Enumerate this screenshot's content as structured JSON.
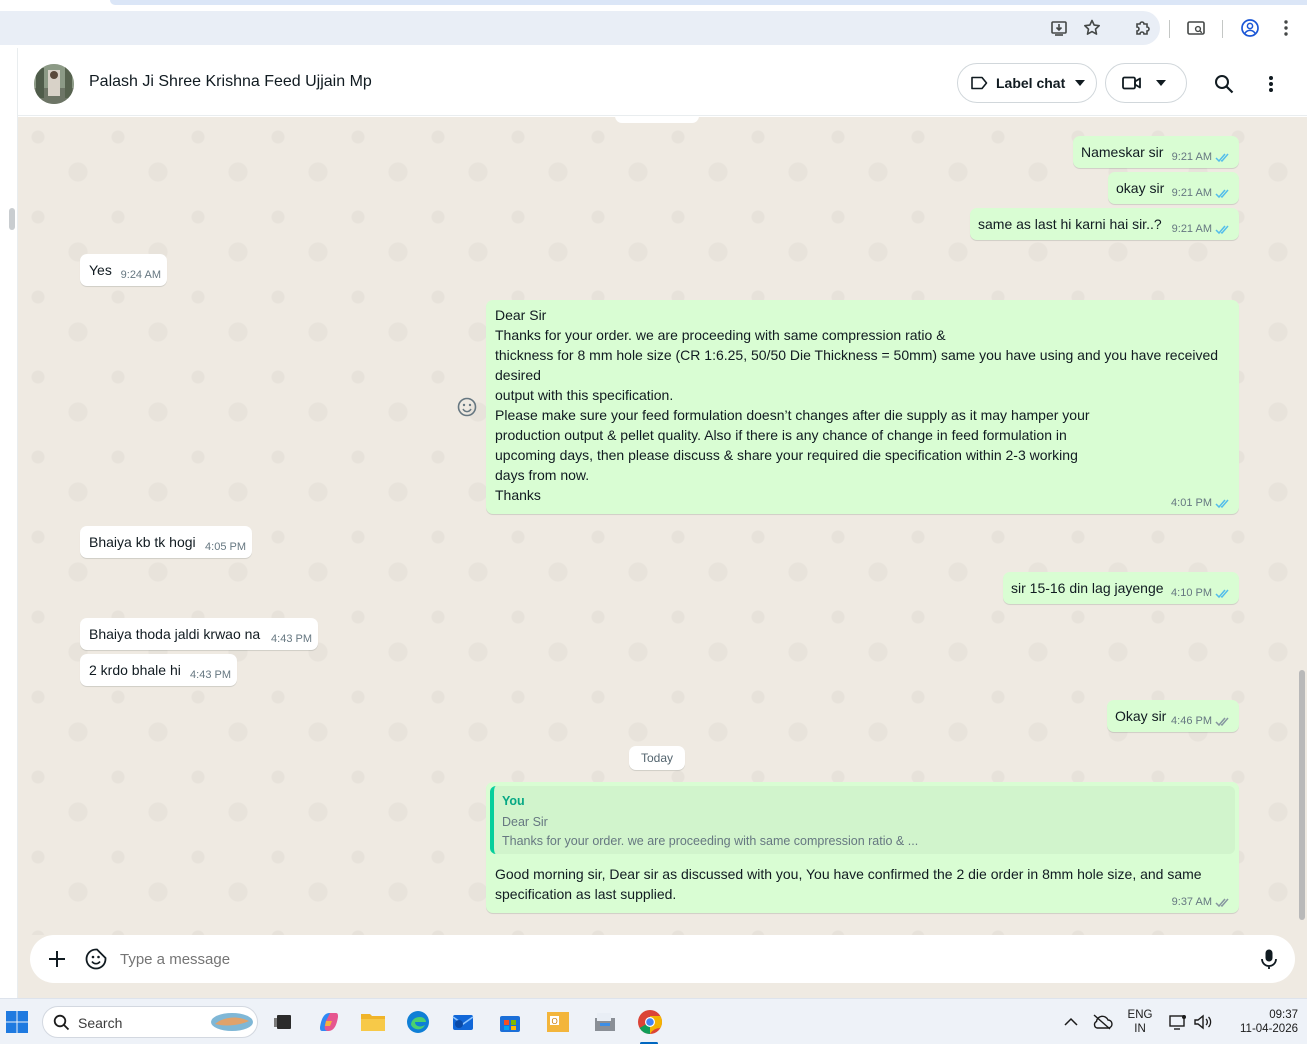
{
  "browser": {
    "icons": [
      "install-app-icon",
      "bookmark-star-icon",
      "extensions-icon",
      "tab-search-icon",
      "profile-icon",
      "menu-dots-icon"
    ]
  },
  "header": {
    "contact_name": "Palash Ji Shree Krishna Feed Ujjain Mp",
    "label_chat": "Label chat"
  },
  "messages": [
    {
      "dir": "out",
      "text": "Nameskar sir",
      "time": "9:21 AM",
      "status": "read"
    },
    {
      "dir": "out",
      "text": "okay sir",
      "time": "9:21 AM",
      "status": "read"
    },
    {
      "dir": "out",
      "text": "same as last hi karni hai sir..?",
      "time": "9:21 AM",
      "status": "read"
    },
    {
      "dir": "in",
      "text": "Yes",
      "time": "9:24 AM"
    },
    {
      "dir": "out",
      "text": "Dear Sir\nThanks for your order. we are proceeding with same compression ratio &\nthickness for 8 mm hole size (CR 1:6.25, 50/50 Die Thickness = 50mm) same you have using and  you have received desired\noutput with this specification.\nPlease make sure your feed formulation doesn’t changes after die supply as it may hamper your\nproduction output & pellet quality. Also if there is any chance of change in feed formulation in\nupcoming days, then please discuss & share your required die specification within 2-3 working\ndays from now.\nThanks",
      "time": "4:01 PM",
      "status": "read"
    },
    {
      "dir": "in",
      "text": "Bhaiya kb tk hogi",
      "time": "4:05 PM"
    },
    {
      "dir": "out",
      "text": "sir 15-16 din lag jayenge",
      "time": "4:10 PM",
      "status": "read"
    },
    {
      "dir": "in",
      "text": "Bhaiya thoda jaldi krwao na",
      "time": "4:43 PM"
    },
    {
      "dir": "in",
      "text": "2 krdo bhale hi",
      "time": "4:43 PM"
    },
    {
      "dir": "out",
      "text": "Okay sir",
      "time": "4:46 PM",
      "status": "delivered"
    }
  ],
  "date_separator": "Today",
  "reply_message": {
    "quote_author": "You",
    "quote_line1": "Dear Sir",
    "quote_line2": "Thanks for your order. we are proceeding with same compression ratio & ...",
    "text": "Good morning sir,  Dear sir as discussed with you,  You have confirmed the 2 die order in 8mm hole size, and same specification as last supplied.",
    "time": "9:37 AM",
    "status": "delivered"
  },
  "composer": {
    "placeholder": "Type a message"
  },
  "taskbar": {
    "search_label": "Search",
    "lang_line1": "ENG",
    "lang_line2": "IN",
    "time": "09:37",
    "date": "11-04-2026"
  },
  "colors": {
    "outgoing_bubble": "#d9fdd3",
    "incoming_bubble": "#ffffff",
    "chat_background": "#efeae2",
    "read_tick": "#53bdeb",
    "accent": "#06cf9c"
  }
}
